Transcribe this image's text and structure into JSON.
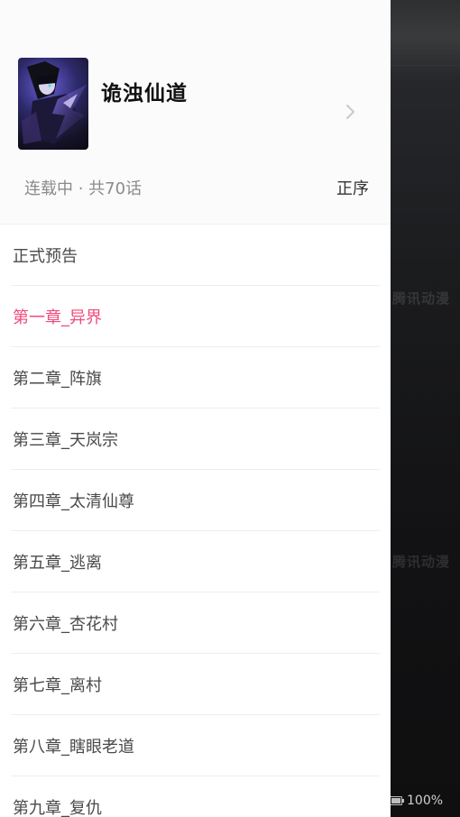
{
  "comic": {
    "title": "诡浊仙道",
    "status_text": "连载中 · 共70话",
    "order_label": "正序"
  },
  "chapters": [
    {
      "label": "正式预告",
      "active": false
    },
    {
      "label": "第一章_异界",
      "active": true
    },
    {
      "label": "第二章_阵旗",
      "active": false
    },
    {
      "label": "第三章_天岚宗",
      "active": false
    },
    {
      "label": "第四章_太清仙尊",
      "active": false
    },
    {
      "label": "第五章_逃离",
      "active": false
    },
    {
      "label": "第六章_杏花村",
      "active": false
    },
    {
      "label": "第七章_离村",
      "active": false
    },
    {
      "label": "第八章_瞎眼老道",
      "active": false
    },
    {
      "label": "第九章_复仇",
      "active": false
    }
  ],
  "background": {
    "watermark": "腾讯动漫"
  },
  "status_bar": {
    "battery_text": "100%"
  },
  "colors": {
    "active_chapter": "#f2497a",
    "drawer_bg": "#ffffff",
    "header_bg": "#fbfbfb"
  },
  "icons": {
    "chevron": "chevron-right-icon",
    "battery": "battery-icon"
  }
}
